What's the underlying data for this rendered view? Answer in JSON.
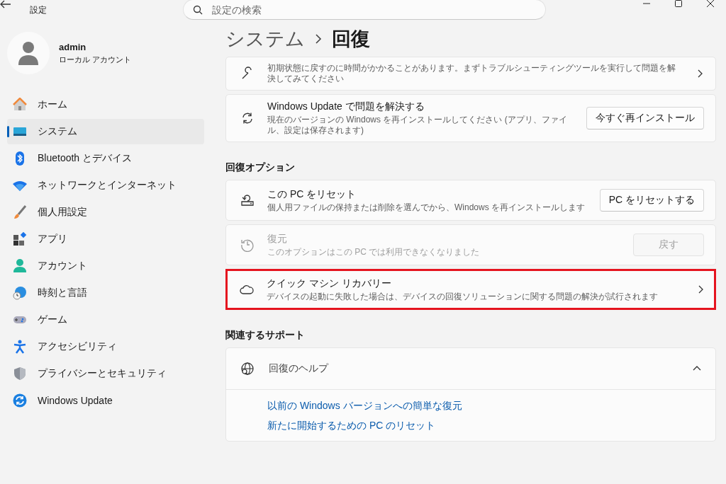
{
  "window": {
    "title": "設定"
  },
  "search": {
    "placeholder": "設定の検索"
  },
  "profile": {
    "name": "admin",
    "account_type": "ローカル アカウント"
  },
  "sidebar": {
    "items": [
      {
        "kind": "home",
        "label": "ホーム",
        "selected": false
      },
      {
        "kind": "system",
        "label": "システム",
        "selected": true
      },
      {
        "kind": "bluetooth",
        "label": "Bluetooth とデバイス",
        "selected": false
      },
      {
        "kind": "network",
        "label": "ネットワークとインターネット",
        "selected": false
      },
      {
        "kind": "personalize",
        "label": "個人用設定",
        "selected": false
      },
      {
        "kind": "apps",
        "label": "アプリ",
        "selected": false
      },
      {
        "kind": "account",
        "label": "アカウント",
        "selected": false
      },
      {
        "kind": "time",
        "label": "時刻と言語",
        "selected": false
      },
      {
        "kind": "gaming",
        "label": "ゲーム",
        "selected": false
      },
      {
        "kind": "accessibility",
        "label": "アクセシビリティ",
        "selected": false
      },
      {
        "kind": "privacy",
        "label": "プライバシーとセキュリティ",
        "selected": false
      },
      {
        "kind": "update",
        "label": "Windows Update",
        "selected": false
      }
    ]
  },
  "breadcrumb": [
    "システム",
    "回復"
  ],
  "content": [
    {
      "kind": "troubleshoot",
      "description": "初期状態に戻すのに時間がかかることがあります。まずトラブルシューティングツールを実行して問題を解決してみてください",
      "disabled": false,
      "highlighted": false
    },
    {
      "kind": "reinstall",
      "title": "Windows Update で問題を解決する",
      "description": "現在のバージョンの Windows を再インストールしてください (アプリ、ファイル、設定は保存されます)",
      "button": "今すぐ再インストール",
      "disabled": false,
      "highlighted": false
    },
    {
      "kind": "heading",
      "text": "回復オプション"
    },
    {
      "kind": "reset",
      "title": "この PC をリセット",
      "description": "個人用ファイルの保持または削除を選んでから、Windows を再インストールします",
      "button": "PC をリセットする",
      "disabled": false,
      "highlighted": false
    },
    {
      "kind": "restore",
      "title": "復元",
      "description": "このオプションはこの PC では利用できなくなりました",
      "button": "戻す",
      "disabled": true,
      "highlighted": false
    },
    {
      "kind": "recovery",
      "title": "クイック マシン リカバリー",
      "description": "デバイスの起動に失敗した場合は、デバイスの回復ソリューションに関する問題の解決が試行されます",
      "disabled": false,
      "highlighted": true
    },
    {
      "kind": "heading",
      "text": "関連するサポート"
    },
    {
      "kind": "expander",
      "title": "回復のヘルプ",
      "expanded": true,
      "links": [
        "以前の Windows バージョンへの簡単な復元",
        "新たに開始するための PC のリセット"
      ]
    }
  ]
}
